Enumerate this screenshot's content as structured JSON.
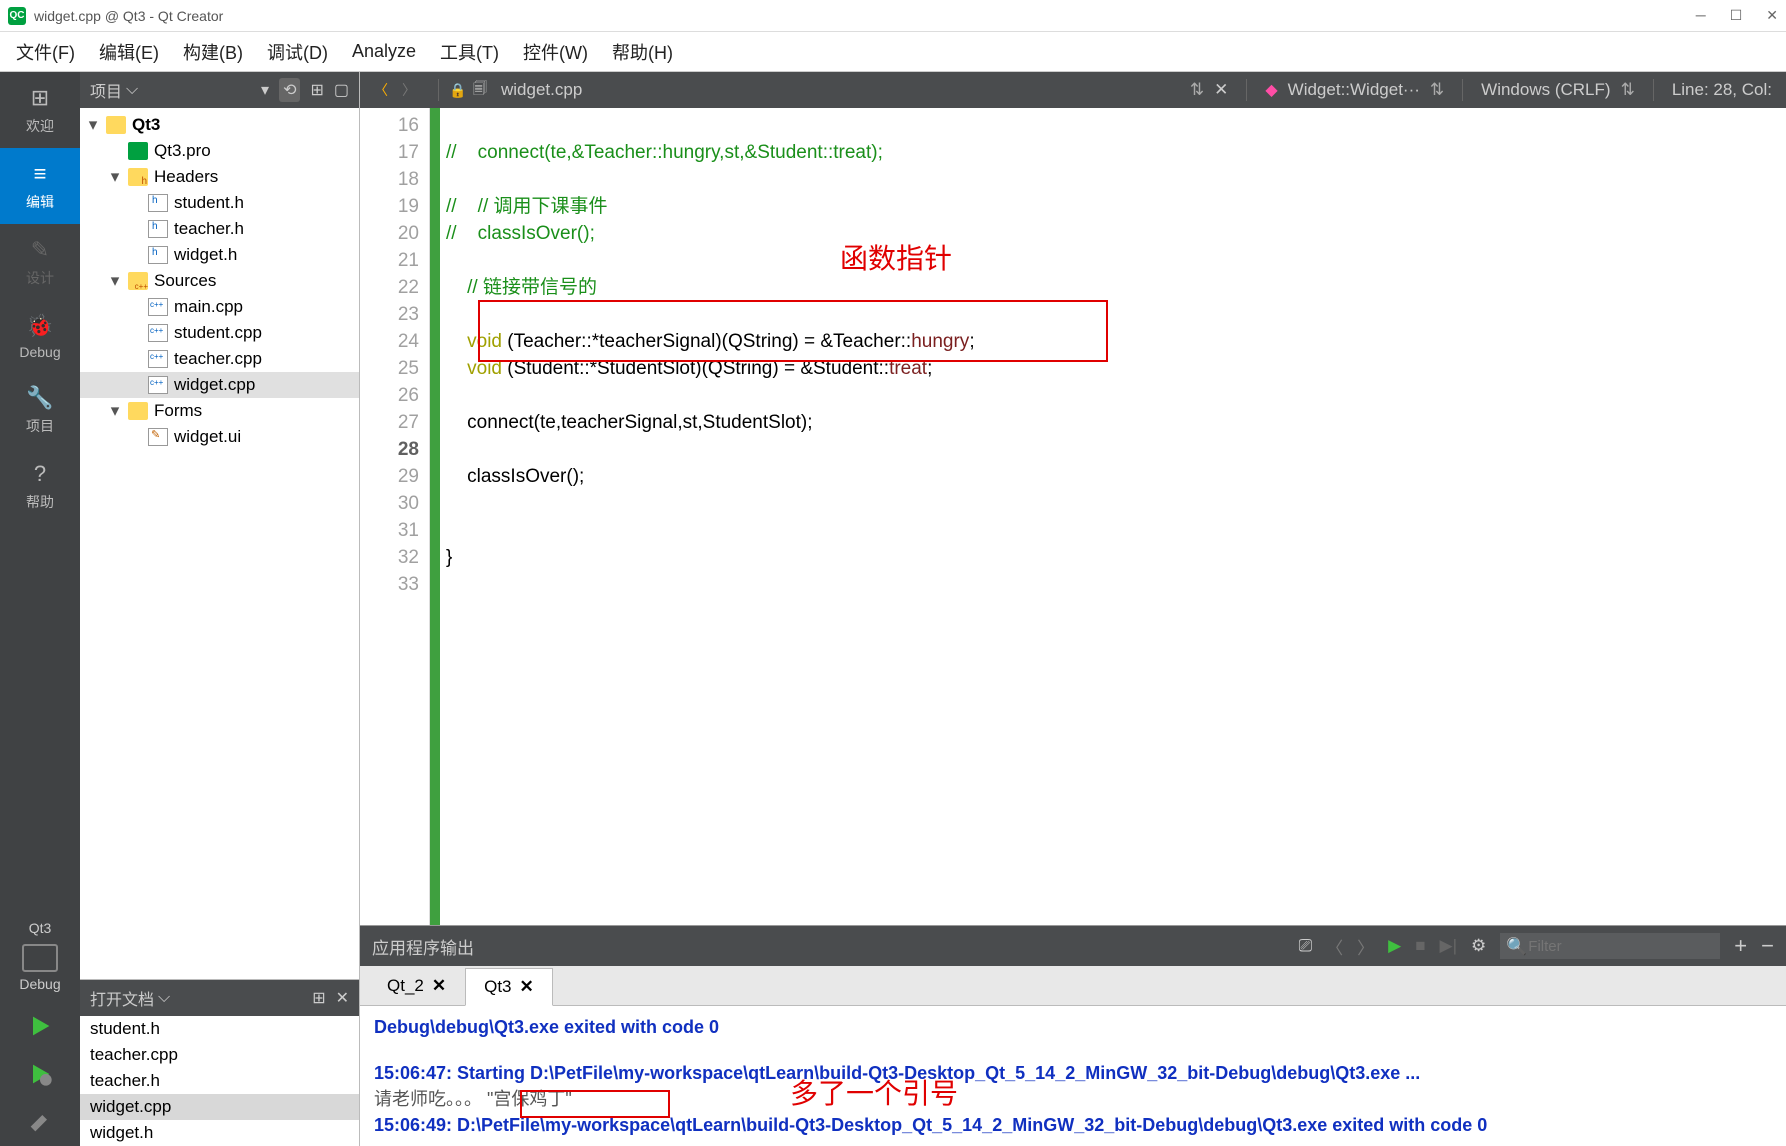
{
  "title": "widget.cpp @ Qt3 - Qt Creator",
  "menu": [
    "文件(F)",
    "编辑(E)",
    "构建(B)",
    "调试(D)",
    "Analyze",
    "工具(T)",
    "控件(W)",
    "帮助(H)"
  ],
  "modes": {
    "welcome": "欢迎",
    "edit": "编辑",
    "design": "设计",
    "debug": "Debug",
    "projects": "项目",
    "help": "帮助"
  },
  "kit": {
    "name": "Qt3",
    "config": "Debug"
  },
  "projpane": {
    "title": "项目"
  },
  "tree": {
    "root": "Qt3",
    "pro": "Qt3.pro",
    "headers": {
      "label": "Headers",
      "items": [
        "student.h",
        "teacher.h",
        "widget.h"
      ]
    },
    "sources": {
      "label": "Sources",
      "items": [
        "main.cpp",
        "student.cpp",
        "teacher.cpp",
        "widget.cpp"
      ]
    },
    "forms": {
      "label": "Forms",
      "items": [
        "widget.ui"
      ]
    }
  },
  "opendocs": {
    "title": "打开文档",
    "items": [
      "student.h",
      "teacher.cpp",
      "teacher.h",
      "widget.cpp",
      "widget.h"
    ],
    "selected": "widget.cpp"
  },
  "edbar": {
    "file": "widget.cpp",
    "symbol": "Widget::Widget···",
    "encoding": "Windows (CRLF)",
    "pos": "Line: 28, Col:"
  },
  "gutter": {
    "start": 16,
    "end": 33,
    "current": 28
  },
  "annot": {
    "fnptr": "函数指针",
    "quote": "多了一个引号"
  },
  "out": {
    "title": "应用程序输出",
    "filter_ph": "Filter",
    "tabs": [
      "Qt_2",
      "Qt3"
    ],
    "active": "Qt3",
    "l1": "Debug\\debug\\Qt3.exe exited with code 0",
    "l2": "15:06:47: Starting D:\\PetFile\\my-workspace\\qtLearn\\build-Qt3-Desktop_Qt_5_14_2_MinGW_32_bit-Debug\\debug\\Qt3.exe ...",
    "l3a": "请老师吃。。。 ",
    "l3b": "\"宫保鸡丁\"",
    "l4": "15:06:49: D:\\PetFile\\my-workspace\\qtLearn\\build-Qt3-Desktop_Qt_5_14_2_MinGW_32_bit-Debug\\debug\\Qt3.exe exited with code 0"
  },
  "code": {
    "l16": "//    connect(te,&Teacher::hungry,st,&Student::treat);",
    "l18": "//    // 调用下课事件",
    "l19": "//    classIsOver();",
    "l21": "// 链接带信号的",
    "l23a": "void",
    "l23b": " (Teacher::*teacherSignal)(QString) = &Teacher::",
    "l23c": "hungry",
    "l23d": ";",
    "l24a": "void",
    "l24b": " (Student::*StudentSlot)(QString) = &Student::",
    "l24c": "treat",
    "l24d": ";",
    "l26": "connect(te,teacherSignal,st,StudentSlot);",
    "l28": "classIsOver();",
    "l31": "}"
  }
}
